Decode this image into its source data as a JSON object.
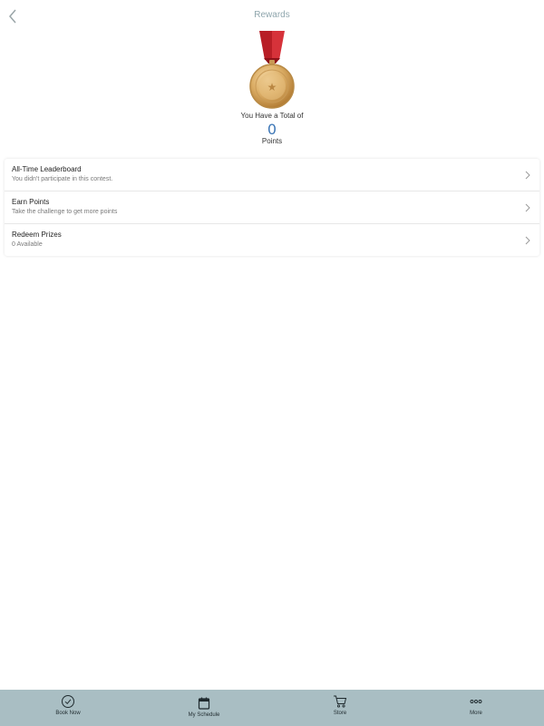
{
  "header": {
    "title": "Rewards",
    "back_icon": "chevron-left-icon"
  },
  "medal": {
    "icon": "medal-icon",
    "ribbon_color": "#c0262d",
    "medal_color": "#d9a85a"
  },
  "summary": {
    "label": "You Have a Total of",
    "points": "0",
    "unit": "Points",
    "points_color": "#3f78b7"
  },
  "list": [
    {
      "title": "All-Time Leaderboard",
      "subtitle": "You didn't participate in this contest."
    },
    {
      "title": "Earn Points",
      "subtitle": "Take the challenge to get more points"
    },
    {
      "title": "Redeem Prizes",
      "subtitle": "0 Available"
    }
  ],
  "tabbar": {
    "background": "#a9bec3",
    "tabs": [
      {
        "label": "Book Now",
        "icon": "check-circle-icon"
      },
      {
        "label": "My Schedule",
        "icon": "calendar-icon"
      },
      {
        "label": "Store",
        "icon": "cart-icon"
      },
      {
        "label": "More",
        "icon": "more-dots-icon"
      }
    ]
  }
}
